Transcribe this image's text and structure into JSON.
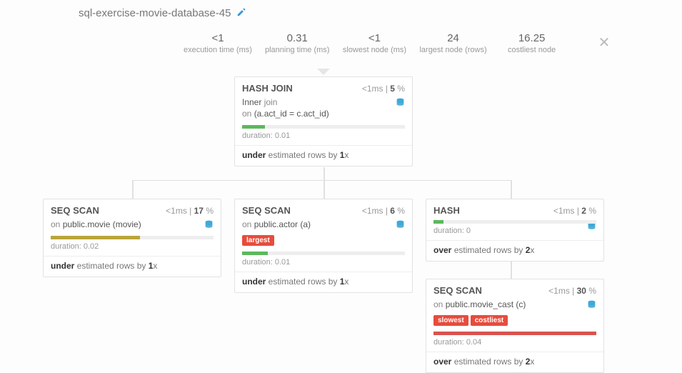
{
  "title": "sql-exercise-movie-database-45",
  "metrics": {
    "exec_val": "<1",
    "exec_lbl": "execution time (ms)",
    "plan_val": "0.31",
    "plan_lbl": "planning time (ms)",
    "slow_val": "<1",
    "slow_lbl": "slowest node (ms)",
    "large_val": "24",
    "large_lbl": "largest node (rows)",
    "cost_val": "16.25",
    "cost_lbl": "costliest node"
  },
  "nodes": {
    "hashjoin": {
      "name": "HASH JOIN",
      "time": "<1",
      "pct": "5",
      "line1a": "Inner",
      "line1b": " join",
      "line2a": "on ",
      "line2b": "(a.act_id = c.act_id)",
      "bar_pct": "14%",
      "bar_class": "bar-green",
      "dur": "duration: 0.01",
      "est_a": "under",
      "est_b": " estimated rows by ",
      "est_c": "1",
      "est_d": "x"
    },
    "seq_movie": {
      "name": "SEQ SCAN",
      "time": "<1",
      "pct": "17",
      "on_a": "on ",
      "on_b": "public.movie (movie)",
      "bar_pct": "55%",
      "bar_class": "bar-olive",
      "dur": "duration: 0.02",
      "est_a": "under",
      "est_b": " estimated rows by ",
      "est_c": "1",
      "est_d": "x"
    },
    "seq_actor": {
      "name": "SEQ SCAN",
      "time": "<1",
      "pct": "6",
      "on_a": "on ",
      "on_b": "public.actor (a)",
      "tag1": "largest",
      "bar_pct": "16%",
      "bar_class": "bar-green",
      "dur": "duration: 0.01",
      "est_a": "under",
      "est_b": " estimated rows by ",
      "est_c": "1",
      "est_d": "x"
    },
    "hash": {
      "name": "HASH",
      "time": "<1",
      "pct": "2",
      "bar_pct": "6%",
      "bar_class": "bar-green",
      "dur": "duration: 0",
      "est_a": "over",
      "est_b": " estimated rows by ",
      "est_c": "2",
      "est_d": "x"
    },
    "seq_cast": {
      "name": "SEQ SCAN",
      "time": "<1",
      "pct": "30",
      "on_a": "on ",
      "on_b": "public.movie_cast (c)",
      "tag1": "slowest",
      "tag2": "costliest",
      "bar_pct": "100%",
      "bar_class": "bar-red",
      "dur": "duration: 0.04",
      "est_a": "over",
      "est_b": " estimated rows by ",
      "est_c": "2",
      "est_d": "x"
    }
  }
}
